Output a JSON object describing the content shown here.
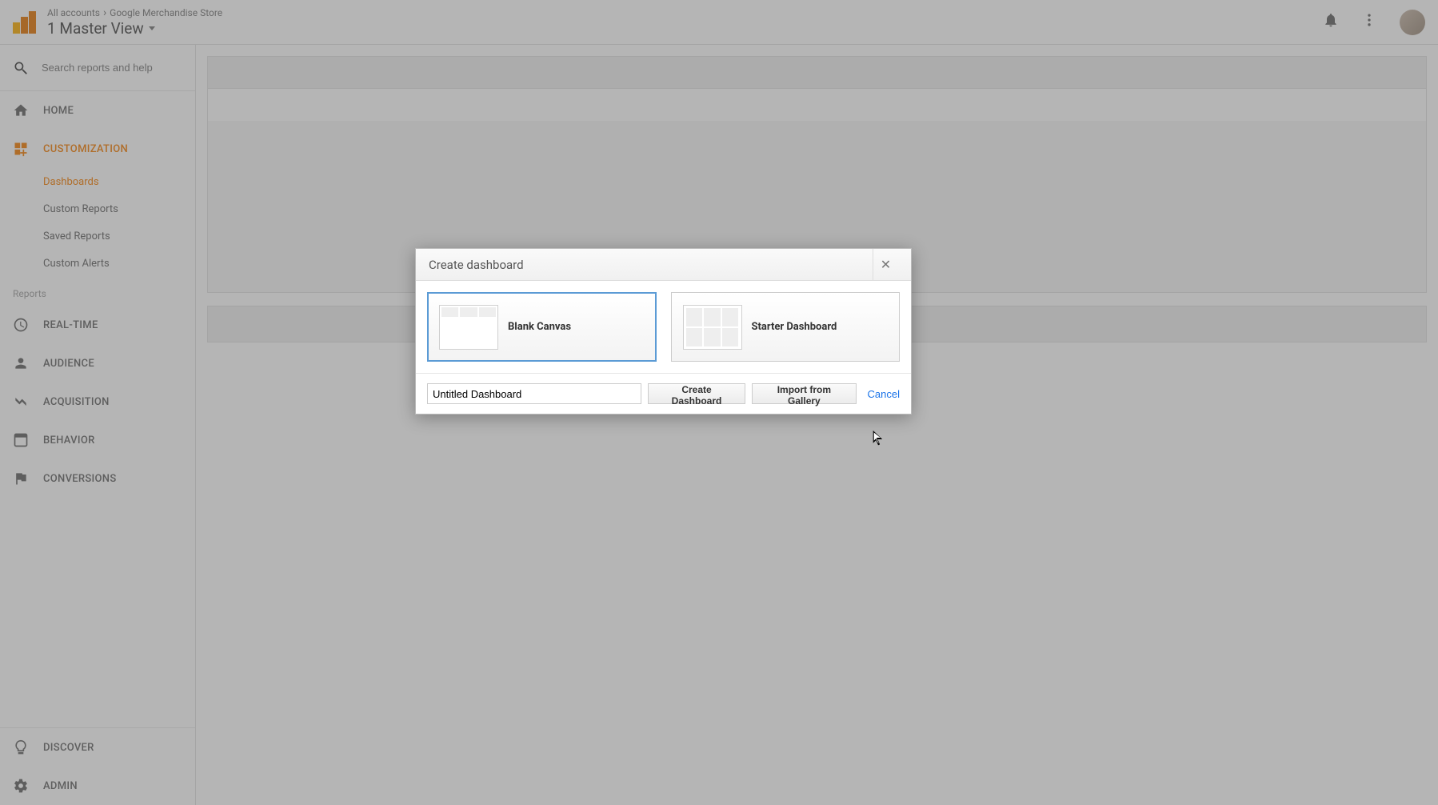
{
  "header": {
    "breadcrumb_all": "All accounts",
    "breadcrumb_property": "Google Merchandise Store",
    "view_name": "1 Master View"
  },
  "sidebar": {
    "search_placeholder": "Search reports and help",
    "home": "HOME",
    "customization": "CUSTOMIZATION",
    "custom_items": {
      "dashboards": "Dashboards",
      "custom_reports": "Custom Reports",
      "saved_reports": "Saved Reports",
      "custom_alerts": "Custom Alerts"
    },
    "reports_label": "Reports",
    "realtime": "REAL-TIME",
    "audience": "AUDIENCE",
    "acquisition": "ACQUISITION",
    "behavior": "BEHAVIOR",
    "conversions": "CONVERSIONS",
    "discover": "DISCOVER",
    "admin": "ADMIN"
  },
  "dialog": {
    "title": "Create dashboard",
    "blank_label": "Blank Canvas",
    "starter_label": "Starter Dashboard",
    "name_value": "Untitled Dashboard",
    "create_btn": "Create Dashboard",
    "import_btn": "Import from Gallery",
    "cancel_btn": "Cancel"
  }
}
